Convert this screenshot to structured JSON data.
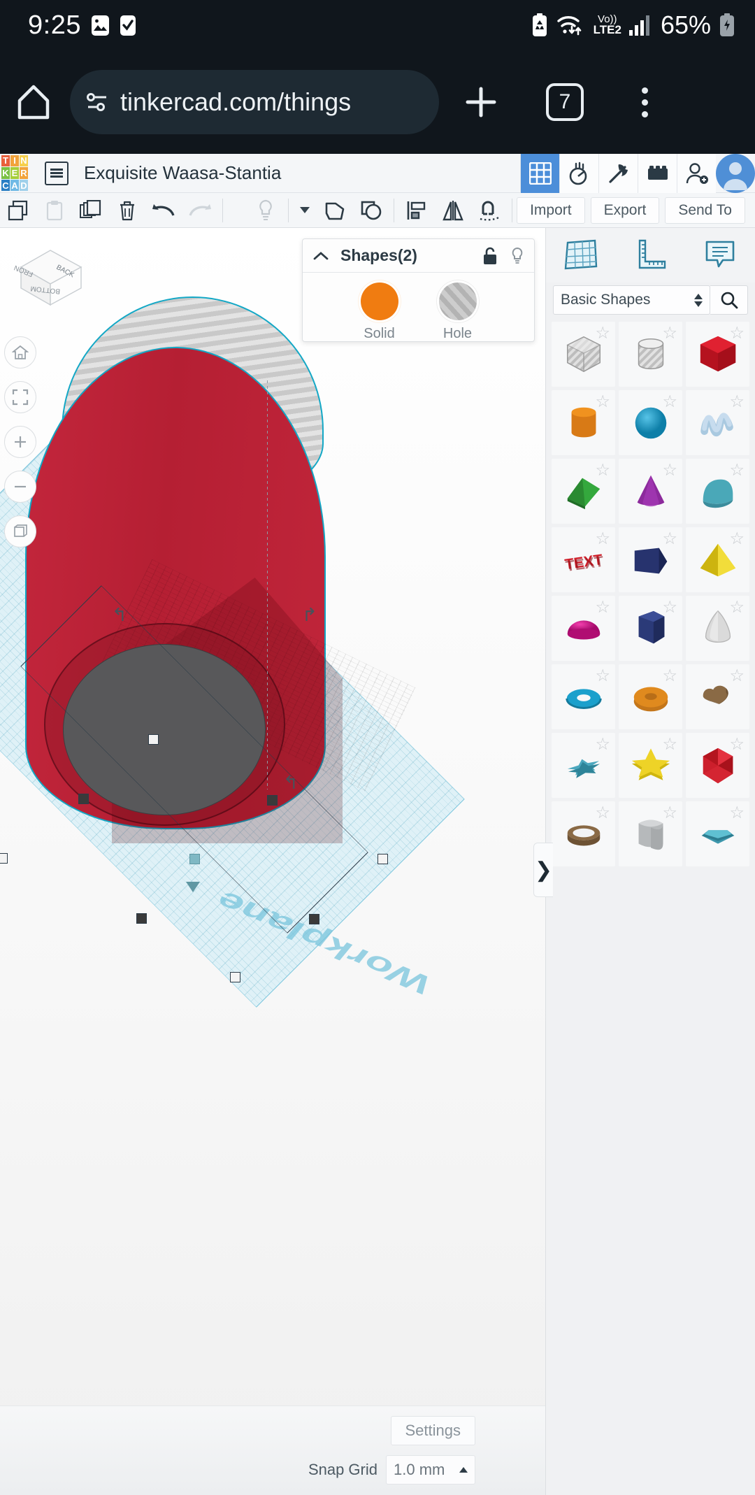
{
  "statusbar": {
    "clock": "9:25",
    "battery_percent": "65%",
    "network_label_top": "Vo))",
    "network_label_bottom": "LTE2",
    "icons": [
      "image-icon",
      "checkbox-icon",
      "battery-saver-icon",
      "wifi-icon",
      "volte-icon",
      "signal-bars-icon",
      "charging-battery-icon"
    ]
  },
  "browser": {
    "url": "tinkercad.com/things",
    "tab_count": "7",
    "icons": [
      "home-icon",
      "page-info-icon",
      "new-tab-icon",
      "tab-switcher-icon",
      "more-menu-icon"
    ]
  },
  "app_header": {
    "logo_letters": [
      "T",
      "I",
      "N",
      "K",
      "E",
      "R",
      "C",
      "A",
      "D"
    ],
    "logo_colors": [
      "#e8603c",
      "#f2a33c",
      "#f6d04d",
      "#7ac143",
      "#a6ce39",
      "#f2a33c",
      "#2b7fc4",
      "#6fb9e5",
      "#9fd0ea"
    ],
    "project_name": "Exquisite Waasa-Stantia",
    "icons": [
      "grid-view-icon",
      "simulator-icon",
      "minecraft-pickaxe-icon",
      "lego-brick-icon",
      "add-person-icon",
      "avatar"
    ]
  },
  "toolbar": {
    "left_icons": [
      "copy-icon",
      "paste-icon",
      "duplicate-icon",
      "delete-icon",
      "undo-icon",
      "redo-icon"
    ],
    "right_icons": [
      "lightbulb-icon",
      "lightbulb-dropdown-caret",
      "group-icon",
      "ungroup-icon",
      "align-icon",
      "mirror-icon",
      "snap-magnet-icon"
    ],
    "import_label": "Import",
    "export_label": "Export",
    "send_to_label": "Send To"
  },
  "canvas": {
    "viewcube_faces": [
      "FRONT",
      "BACK",
      "BOTTOM"
    ],
    "nav_buttons": [
      "home-view-icon",
      "fit-to-view-icon",
      "zoom-in-icon",
      "zoom-out-icon",
      "perspective-toggle-icon"
    ],
    "workplane_label": "Workplane",
    "objects": [
      {
        "name": "hole-cylinder",
        "type": "hole",
        "color": "#c9c9c9"
      },
      {
        "name": "red-cylinder",
        "type": "solid",
        "color": "#b51f33"
      }
    ]
  },
  "shapes_panel": {
    "title": "Shapes(2)",
    "collapse_icon": "chevron-up-icon",
    "lock_icon": "unlocked-padlock-icon",
    "light_icon": "lightbulb-icon",
    "options": [
      {
        "label": "Solid",
        "color": "#f07c11",
        "selected": true
      },
      {
        "label": "Hole",
        "color": "#c0c0c0",
        "selected": false
      }
    ]
  },
  "sidebar": {
    "tabs": [
      "workplane-icon",
      "ruler-icon",
      "notes-icon"
    ],
    "category_selected": "Basic Shapes",
    "search_icon": "search-icon",
    "collapse_arrow": "❯",
    "favorite_icon": "star-outline-icon",
    "shapes": [
      {
        "name": "box-hole",
        "kind": "cube",
        "color": "#d7d7d7",
        "hatched": true
      },
      {
        "name": "cylinder-hole",
        "kind": "cylinder",
        "color": "#d2d2d2",
        "hatched": true
      },
      {
        "name": "box",
        "kind": "cube",
        "color": "#c8202f",
        "hatched": false
      },
      {
        "name": "cylinder",
        "kind": "cylinder",
        "color": "#e07b1b",
        "hatched": false
      },
      {
        "name": "sphere",
        "kind": "sphere",
        "color": "#1796c4",
        "hatched": false
      },
      {
        "name": "scribble",
        "kind": "scribble",
        "color": "#a9c9e0",
        "hatched": false
      },
      {
        "name": "roof",
        "kind": "wedge",
        "color": "#2d9436",
        "hatched": false
      },
      {
        "name": "cone",
        "kind": "cone",
        "color": "#8c2a9c",
        "hatched": false
      },
      {
        "name": "round-roof",
        "kind": "roundroof",
        "color": "#4aa8b8",
        "hatched": false
      },
      {
        "name": "text",
        "kind": "text",
        "color": "#cf1f2a",
        "hatched": false
      },
      {
        "name": "polygon-prism",
        "kind": "polyprism",
        "color": "#27336e",
        "hatched": false
      },
      {
        "name": "pyramid",
        "kind": "pyramid",
        "color": "#e8cf16",
        "hatched": false
      },
      {
        "name": "half-sphere",
        "kind": "dome",
        "color": "#d5118a",
        "hatched": false
      },
      {
        "name": "hexagonal-prism",
        "kind": "hexprism",
        "color": "#2b3a78",
        "hatched": false
      },
      {
        "name": "paraboloid",
        "kind": "paraboloid",
        "color": "#d6d6d6",
        "hatched": false
      },
      {
        "name": "torus",
        "kind": "torus",
        "color": "#1ba0cc",
        "hatched": false
      },
      {
        "name": "donut",
        "kind": "donut",
        "color": "#e08a1e",
        "hatched": false
      },
      {
        "name": "heart",
        "kind": "heart",
        "color": "#8a6a45",
        "hatched": false
      },
      {
        "name": "star-thin",
        "kind": "star",
        "color": "#4ba7be",
        "hatched": false
      },
      {
        "name": "star",
        "kind": "star",
        "color": "#e2c game",
        "hatched": false
      },
      {
        "name": "polyhedron",
        "kind": "polyhedron",
        "color": "#cc1f2c",
        "hatched": false
      },
      {
        "name": "tube",
        "kind": "tube",
        "color": "#8a6a45",
        "hatched": false
      },
      {
        "name": "rounded-cube",
        "kind": "roundedcube",
        "color": "#b9bcbe",
        "hatched": false
      },
      {
        "name": "gem",
        "kind": "gem",
        "color": "#4fb5c9",
        "hatched": false
      }
    ]
  },
  "bottombar": {
    "settings_label": "Settings",
    "snap_grid_label": "Snap Grid",
    "snap_grid_value": "1.0 mm"
  }
}
